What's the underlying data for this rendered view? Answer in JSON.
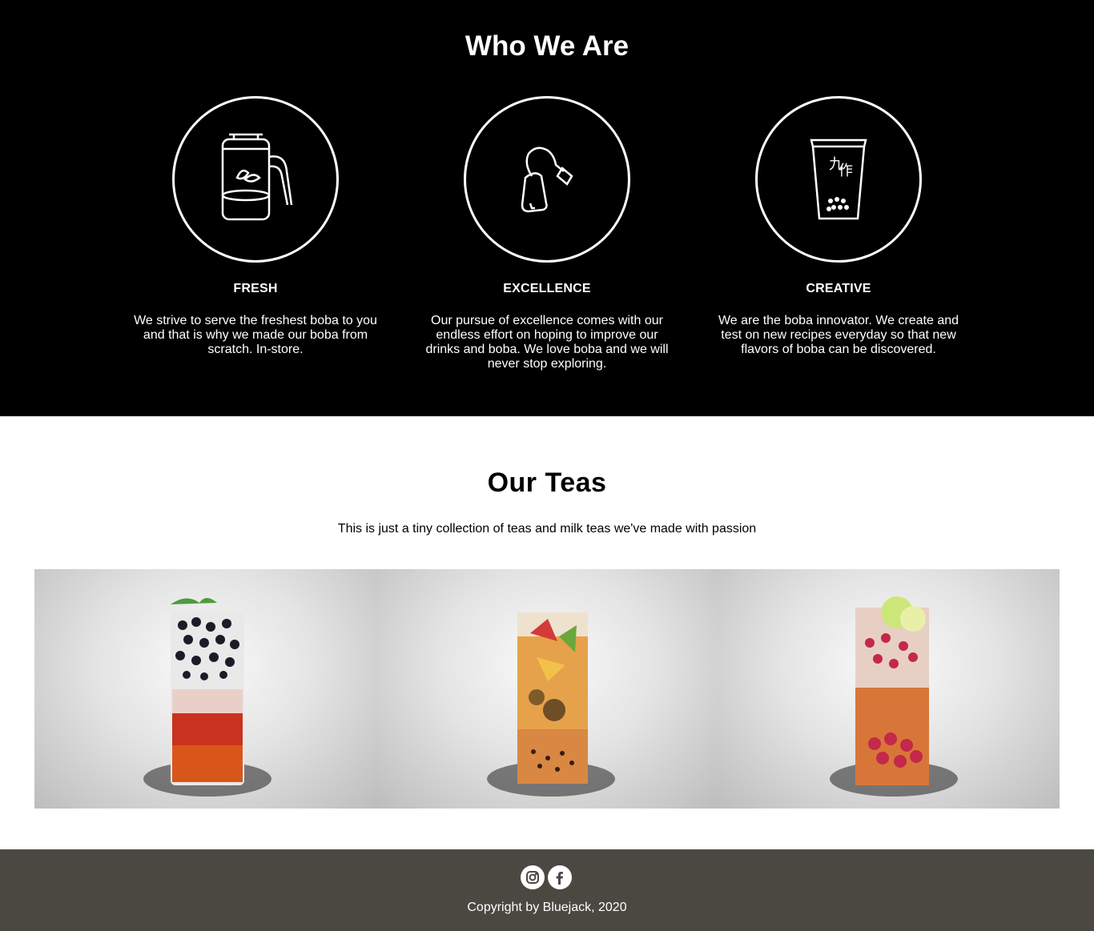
{
  "who": {
    "title": "Who We Are",
    "features": [
      {
        "title": "FRESH",
        "text": "We strive to serve the freshest boba to you and that is why we made our boba from scratch. In-store.",
        "icon": "tea-pot-icon"
      },
      {
        "title": "EXCELLENCE",
        "text": "Our pursue of excellence comes with our endless effort on hoping to improve our drinks and boba. We love boba and we will never stop exploring.",
        "icon": "tea-bag-icon"
      },
      {
        "title": "CREATIVE",
        "text": "We are the boba innovator. We create and test on new recipes everyday so that new flavors of boba can be discovered.",
        "icon": "boba-cup-icon"
      }
    ]
  },
  "teas": {
    "title": "Our Teas",
    "subtitle": "This is just a tiny collection of teas and milk teas we've made with passion"
  },
  "footer": {
    "copyright": "Copyright by Bluejack, 2020",
    "social": [
      "instagram-icon",
      "facebook-icon"
    ]
  },
  "colors": {
    "hero_bg": "#000000",
    "footer_bg": "#4b4842",
    "text_light": "#ffffff"
  }
}
